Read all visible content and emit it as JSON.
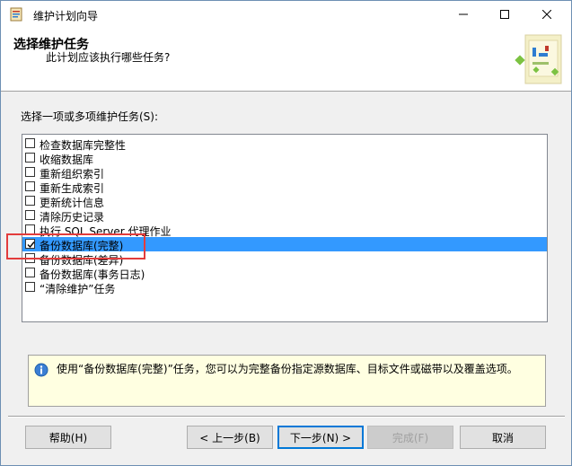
{
  "window": {
    "title": "维护计划向导"
  },
  "header": {
    "title": "选择维护任务",
    "subtitle": "此计划应该执行哪些任务?"
  },
  "task_list": {
    "label": "选择一项或多项维护任务(S):",
    "items": [
      {
        "label": "检查数据库完整性",
        "checked": false,
        "selected": false
      },
      {
        "label": "收缩数据库",
        "checked": false,
        "selected": false
      },
      {
        "label": "重新组织索引",
        "checked": false,
        "selected": false
      },
      {
        "label": "重新生成索引",
        "checked": false,
        "selected": false
      },
      {
        "label": "更新统计信息",
        "checked": false,
        "selected": false
      },
      {
        "label": "清除历史记录",
        "checked": false,
        "selected": false
      },
      {
        "label": "执行 SQL Server 代理作业",
        "checked": false,
        "selected": false
      },
      {
        "label": "备份数据库(完整)",
        "checked": true,
        "selected": true
      },
      {
        "label": "备份数据库(差异)",
        "checked": false,
        "selected": false
      },
      {
        "label": "备份数据库(事务日志)",
        "checked": false,
        "selected": false
      },
      {
        "label": "“清除维护”任务",
        "checked": false,
        "selected": false
      }
    ]
  },
  "description": {
    "text": "使用“备份数据库(完整)”任务，您可以为完整备份指定源数据库、目标文件或磁带以及覆盖选项。"
  },
  "buttons": {
    "help": "帮助(H)",
    "back": "< 上一步(B)",
    "next": "下一步(N) >",
    "finish": "完成(F)",
    "cancel": "取消"
  },
  "colors": {
    "selection": "#3399ff",
    "highlight_box": "#e33c3c",
    "info_bg": "#ffffe1",
    "default_button_border": "#0078d7"
  },
  "icons": {
    "app": "app-icon",
    "minimize": "minimize-icon",
    "maximize": "maximize-icon",
    "close": "close-icon",
    "info": "info-icon"
  }
}
